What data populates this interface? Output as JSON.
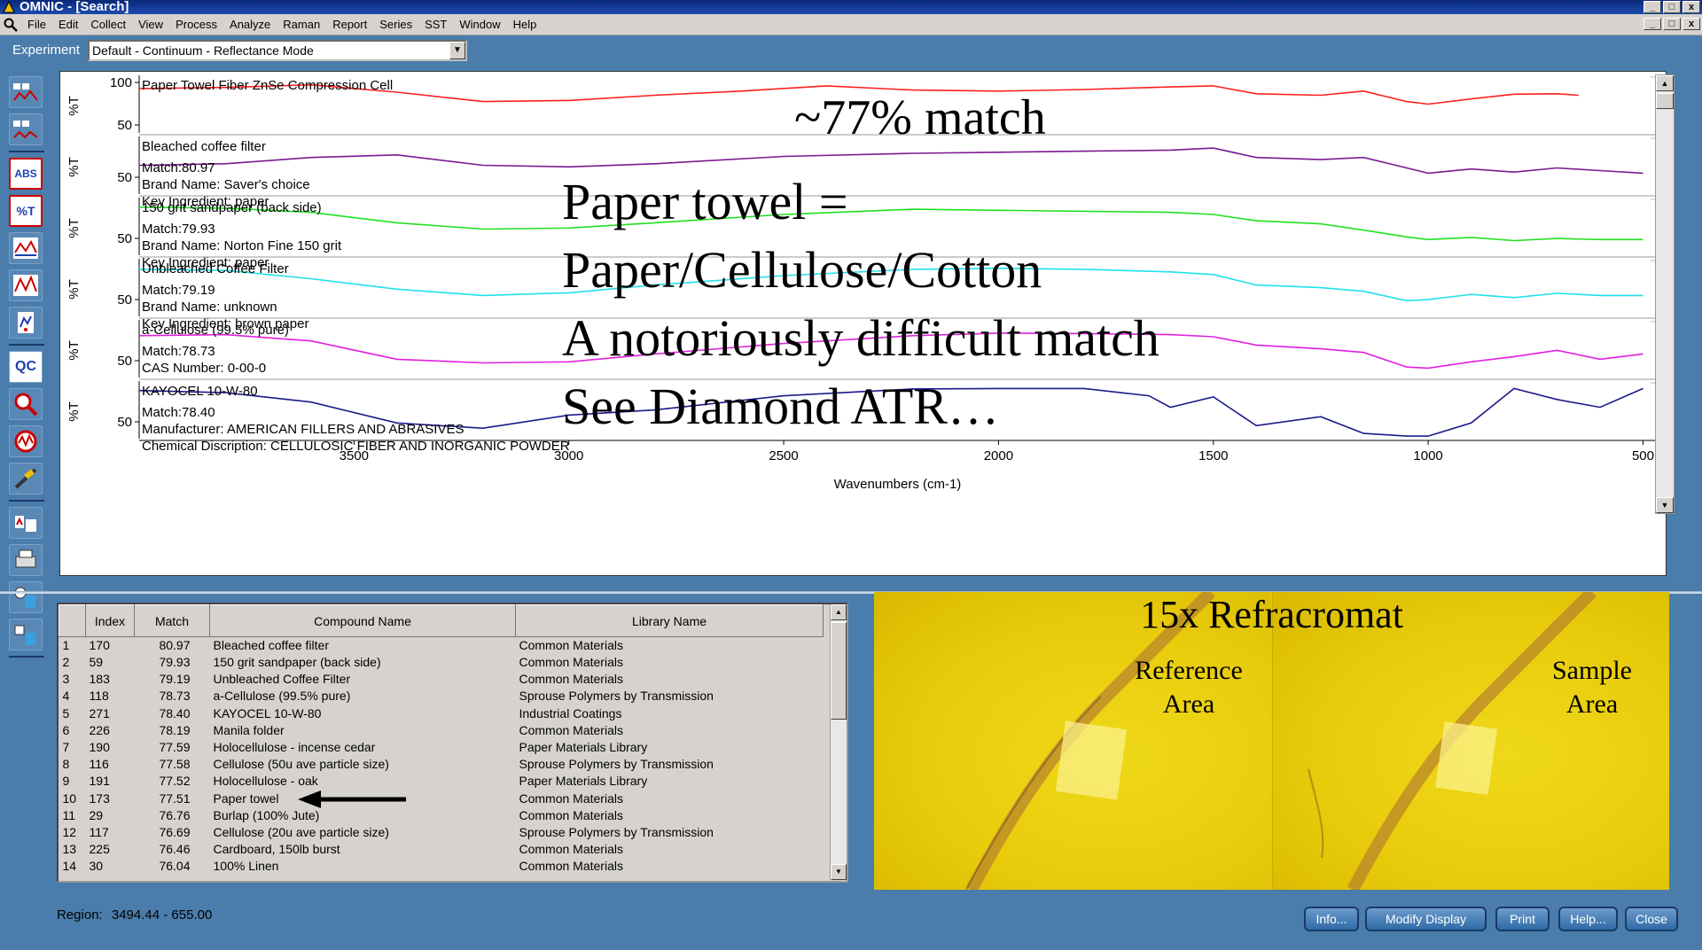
{
  "window": {
    "title": "OMNIC - [Search]",
    "controls": [
      "_",
      "□",
      "x"
    ]
  },
  "menu": [
    "File",
    "Edit",
    "Collect",
    "View",
    "Process",
    "Analyze",
    "Raman",
    "Report",
    "Series",
    "SST",
    "Window",
    "Help"
  ],
  "experiment": {
    "label": "Experiment",
    "value": "Default - Continuum - Reflectance Mode"
  },
  "toolbar_icons": [
    "spectrum-collect-icon",
    "background-collect-icon",
    "absorbance-icon",
    "percent-transmittance-icon",
    "baseline-correct-icon",
    "autobaseline-icon",
    "full-scale-icon",
    "qc-compare-icon",
    "search-icon",
    "find-peaks-icon",
    "edit-tool-icon",
    "library-setup-icon",
    "print-report-icon",
    "spectral-math-icon",
    "compare-icon"
  ],
  "toolbar_labels": {
    "abs": "ABS",
    "pct": "%T",
    "qc": "QC"
  },
  "chart_data": {
    "type": "line",
    "xlabel": "Wavenumbers (cm-1)",
    "x_ticks": [
      "3500",
      "3000",
      "2500",
      "2000",
      "1500",
      "1000",
      "500"
    ],
    "xlim": [
      4000,
      470
    ],
    "ylabel": "%T",
    "log_scale": false,
    "grid": false,
    "series": [
      {
        "name": "Paper Towel Fiber ZnSe Compression Cell",
        "color": "#ff2020",
        "y_ticks": [
          "100",
          "50"
        ],
        "lines": [],
        "x": [
          4000,
          3800,
          3600,
          3400,
          3200,
          3000,
          2800,
          2600,
          2400,
          2200,
          2000,
          1800,
          1600,
          1500,
          1400,
          1250,
          1150,
          1050,
          1000,
          900,
          800,
          700,
          650
        ],
        "y": [
          85,
          87,
          92,
          78,
          60,
          62,
          72,
          80,
          90,
          82,
          80,
          83,
          88,
          90,
          75,
          72,
          80,
          60,
          55,
          65,
          74,
          75,
          72
        ]
      },
      {
        "name": "Bleached coffee filter",
        "color": "#7a1a90",
        "y_ticks": [
          "50"
        ],
        "lines": [
          "Match:80.97",
          "Brand Name:  Saver's choice",
          "Key Ingredient:  paper"
        ],
        "x": [
          4000,
          3800,
          3600,
          3400,
          3200,
          3000,
          2800,
          2500,
          2200,
          2000,
          1800,
          1600,
          1500,
          1400,
          1250,
          1150,
          1050,
          1000,
          900,
          800,
          700,
          600,
          500
        ],
        "y": [
          55,
          58,
          70,
          75,
          55,
          52,
          58,
          72,
          78,
          80,
          82,
          84,
          88,
          70,
          66,
          70,
          50,
          40,
          48,
          42,
          50,
          45,
          40
        ]
      },
      {
        "name": "150 grit sandpaper (back side)",
        "color": "#20e020",
        "y_ticks": [
          "50"
        ],
        "lines": [
          "Match:79.93",
          "Brand Name:  Norton Fine 150 grit",
          "Key Ingredient:  paper"
        ],
        "x": [
          4000,
          3800,
          3600,
          3400,
          3200,
          3000,
          2800,
          2500,
          2200,
          2000,
          1800,
          1600,
          1500,
          1400,
          1250,
          1150,
          1050,
          1000,
          900,
          800,
          700,
          600,
          500
        ],
        "y": [
          92,
          90,
          82,
          62,
          50,
          52,
          62,
          78,
          88,
          86,
          84,
          82,
          78,
          66,
          60,
          48,
          35,
          30,
          34,
          28,
          32,
          30,
          30
        ]
      },
      {
        "name": "Unbleached Coffee Filter",
        "color": "#20e0e8",
        "y_ticks": [
          "50"
        ],
        "lines": [
          "Match:79.19",
          "Brand Name:  unknown",
          "Key Ingredient:  brown paper"
        ],
        "x": [
          4000,
          3800,
          3600,
          3400,
          3200,
          3000,
          2800,
          2500,
          2200,
          2000,
          1800,
          1600,
          1500,
          1400,
          1250,
          1150,
          1050,
          1000,
          900,
          800,
          700,
          600,
          500
        ],
        "y": [
          90,
          88,
          72,
          52,
          40,
          45,
          60,
          78,
          90,
          92,
          90,
          85,
          80,
          60,
          55,
          48,
          30,
          32,
          42,
          36,
          44,
          40,
          40
        ]
      },
      {
        "name": "a-Cellulose (99.5% pure)",
        "color": "#e020e0",
        "y_ticks": [
          "50"
        ],
        "lines": [
          "Match:78.73",
          "CAS Number:      0-00-0"
        ],
        "x": [
          4000,
          3800,
          3600,
          3400,
          3200,
          3000,
          2800,
          2500,
          2200,
          2000,
          1800,
          1600,
          1500,
          1400,
          1250,
          1150,
          1050,
          1000,
          900,
          800,
          700,
          600,
          500
        ],
        "y": [
          80,
          82,
          70,
          35,
          28,
          30,
          45,
          65,
          80,
          85,
          84,
          82,
          78,
          62,
          55,
          48,
          20,
          18,
          30,
          40,
          52,
          35,
          45
        ]
      },
      {
        "name": "KAYOCEL 10-W-80",
        "color": "#1a1a8a",
        "y_ticks": [
          "50"
        ],
        "lines": [
          "Match:78.40",
          "Manufacturer:  AMERICAN FILLERS AND ABRASIVES",
          "Chemical Discription:  CELLULOSIC FIBER AND INORGANIC POWDER"
        ],
        "x": [
          4000,
          3800,
          3600,
          3400,
          3200,
          3000,
          2800,
          2500,
          2200,
          2000,
          1800,
          1650,
          1600,
          1500,
          1400,
          1250,
          1150,
          1050,
          1000,
          900,
          800,
          700,
          600,
          500
        ],
        "y": [
          92,
          88,
          70,
          30,
          20,
          45,
          55,
          82,
          95,
          96,
          96,
          82,
          60,
          80,
          25,
          42,
          10,
          5,
          5,
          30,
          96,
          75,
          60,
          96
        ]
      }
    ]
  },
  "overlay_text": {
    "match": "~77% match",
    "line1": "Paper towel =",
    "line2": "Paper/Cellulose/Cotton",
    "line3": "A notoriously difficult match",
    "line4": "See Diamond ATR…"
  },
  "results_table": {
    "headers": [
      "",
      "Index",
      "Match",
      "Compound Name",
      "Library Name"
    ],
    "rows": [
      [
        "1",
        "170",
        "80.97",
        "Bleached coffee filter",
        "Common Materials"
      ],
      [
        "2",
        "59",
        "79.93",
        "150 grit sandpaper (back side)",
        "Common Materials"
      ],
      [
        "3",
        "183",
        "79.19",
        "Unbleached Coffee Filter",
        "Common Materials"
      ],
      [
        "4",
        "118",
        "78.73",
        "a-Cellulose (99.5% pure)",
        "Sprouse Polymers by Transmission"
      ],
      [
        "5",
        "271",
        "78.40",
        "KAYOCEL 10-W-80",
        "Industrial Coatings"
      ],
      [
        "6",
        "226",
        "78.19",
        "Manila folder",
        "Common Materials"
      ],
      [
        "7",
        "190",
        "77.59",
        "Holocellulose - incense cedar",
        "Paper Materials Library"
      ],
      [
        "8",
        "116",
        "77.58",
        "Cellulose (50u ave particle size)",
        "Sprouse Polymers by Transmission"
      ],
      [
        "9",
        "191",
        "77.52",
        "Holocellulose - oak",
        "Paper Materials Library"
      ],
      [
        "10",
        "173",
        "77.51",
        "Paper towel",
        "Common Materials"
      ],
      [
        "11",
        "29",
        "76.76",
        "Burlap (100% Jute)",
        "Common Materials"
      ],
      [
        "12",
        "117",
        "76.69",
        "Cellulose (20u ave particle size)",
        "Sprouse Polymers by Transmission"
      ],
      [
        "13",
        "225",
        "76.46",
        "Cardboard, 150lb burst",
        "Common Materials"
      ],
      [
        "14",
        "30",
        "76.04",
        "100% Linen",
        "Common Materials"
      ]
    ]
  },
  "microscope": {
    "title": "15x Refracromat",
    "left_label_1": "Reference",
    "left_label_2": "Area",
    "right_label_1": "Sample",
    "right_label_2": "Area"
  },
  "status": {
    "region_label": "Region:",
    "region_value": "3494.44  -  655.00"
  },
  "buttons": {
    "info": "Info...",
    "modify": "Modify Display",
    "print": "Print",
    "help": "Help...",
    "close": "Close"
  }
}
